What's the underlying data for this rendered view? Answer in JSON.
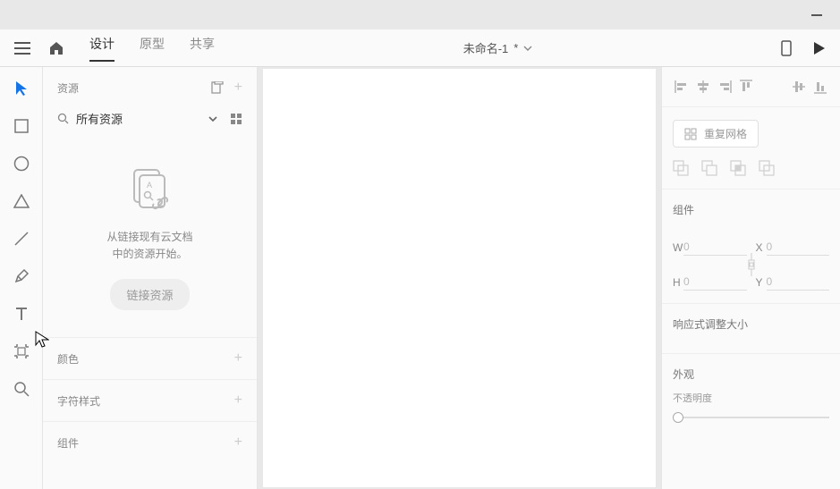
{
  "titlebar": {},
  "topbar": {
    "tabs": {
      "design": "设计",
      "prototype": "原型",
      "share": "共享"
    },
    "doc_title": "未命名-1",
    "modified": "*"
  },
  "leftpanel": {
    "assets_title": "资源",
    "search_label": "所有资源",
    "empty_msg_l1": "从链接现有云文档",
    "empty_msg_l2": "中的资源开始。",
    "link_btn": "链接资源",
    "sections": {
      "colors": "颜色",
      "char_styles": "字符样式",
      "components": "组件"
    }
  },
  "rightpanel": {
    "repeat_grid": "重复网格",
    "components": "组件",
    "dims": {
      "w_label": "W",
      "w": "0",
      "h_label": "H",
      "h": "0",
      "x_label": "X",
      "x": "0",
      "y_label": "Y",
      "y": "0"
    },
    "responsive": "响应式调整大小",
    "appearance": "外观",
    "opacity": "不透明度"
  }
}
